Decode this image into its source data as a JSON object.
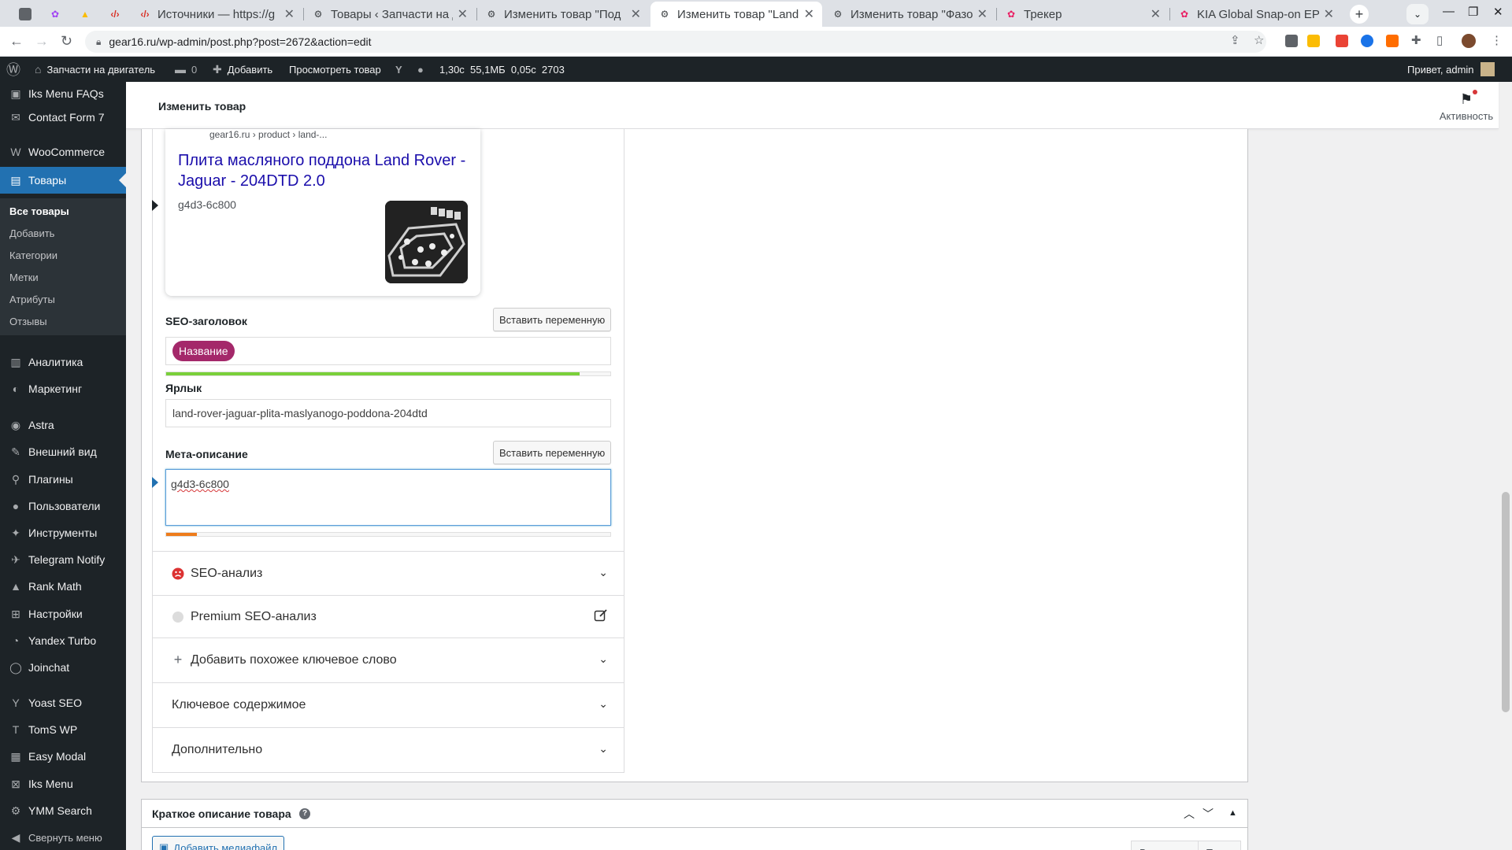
{
  "browser": {
    "tabs": [
      {
        "title": "",
        "favicon_color": "#5f6368"
      },
      {
        "title": "",
        "favicon_color": "#a142f4"
      },
      {
        "title": "",
        "favicon_color": "#fbbc04"
      },
      {
        "title": "",
        "favicon_color": "#d93025"
      },
      {
        "title": "Источники — https://g",
        "favicon_color": "#d93025"
      },
      {
        "title": "Товары ‹ Запчасти на д",
        "favicon_color": "#1d2327"
      },
      {
        "title": "Изменить товар \"Под",
        "favicon_color": "#1d2327"
      },
      {
        "title": "Изменить товар \"Land",
        "favicon_color": "#1d2327"
      },
      {
        "title": "Изменить товар \"Фазо",
        "favicon_color": "#1d2327"
      },
      {
        "title": "Трекер",
        "favicon_color": "#e91e63"
      },
      {
        "title": "KIA Global Snap-on EPC",
        "favicon_color": "#e91e63"
      }
    ],
    "url": "gear16.ru/wp-admin/post.php?post=2672&action=edit"
  },
  "adminbar": {
    "site_name": "Запчасти на двигатель",
    "comments_count": "0",
    "add_new": "Добавить",
    "view_product": "Просмотреть товар",
    "perf": "1,30с  55,1МБ  0,05с  2703",
    "greeting": "Привет, admin"
  },
  "sidebar": {
    "items": [
      {
        "label": "Iks Menu FAQs",
        "icon": "▣"
      },
      {
        "label": "Contact Form 7",
        "icon": "✉"
      },
      {
        "label": "WooCommerce",
        "icon": "W"
      },
      {
        "label": "Товары",
        "icon": "▤"
      },
      {
        "label": "Аналитика",
        "icon": "▥"
      },
      {
        "label": "Маркетинг",
        "icon": "◐"
      },
      {
        "label": "Astra",
        "icon": "◉"
      },
      {
        "label": "Внешний вид",
        "icon": "✎"
      },
      {
        "label": "Плагины",
        "icon": "⚲"
      },
      {
        "label": "Пользователи",
        "icon": "●"
      },
      {
        "label": "Инструменты",
        "icon": "✦"
      },
      {
        "label": "Telegram Notify",
        "icon": "✈"
      },
      {
        "label": "Rank Math",
        "icon": "▲"
      },
      {
        "label": "Настройки",
        "icon": "⊞"
      },
      {
        "label": "Yandex Turbo",
        "icon": "◔"
      },
      {
        "label": "Joinchat",
        "icon": "◯"
      },
      {
        "label": "Yoast SEO",
        "icon": "Y"
      },
      {
        "label": "TomS WP",
        "icon": "T"
      },
      {
        "label": "Easy Modal",
        "icon": "▦"
      },
      {
        "label": "Iks Menu",
        "icon": "⊠"
      },
      {
        "label": "YMM Search",
        "icon": "⚙"
      },
      {
        "label": "Свернуть меню",
        "icon": "◀"
      }
    ],
    "submenu": [
      "Все товары",
      "Добавить",
      "Категории",
      "Метки",
      "Атрибуты",
      "Отзывы"
    ]
  },
  "page": {
    "title": "Изменить товар",
    "activity": "Активность"
  },
  "snippet": {
    "breadcrumb": "gear16.ru › product › land-...",
    "title": "Плита масляного поддона Land Rover - Jaguar - 204DTD 2.0",
    "description": "g4d3-6c800"
  },
  "seo": {
    "seo_title_label": "SEO-заголовок",
    "insert_variable": "Вставить переменную",
    "title_variable_pill": "Название",
    "title_score": 0.93,
    "slug_label": "Ярлык",
    "slug_value": "land-rover-jaguar-plita-maslyanogo-poddona-204dtd",
    "meta_label": "Мета-описание",
    "meta_value": "g4d3-6c800",
    "meta_score": 0.07,
    "colors": {
      "good": "#7ad03a",
      "bad": "#ee7c1b",
      "pill": "#a4286a",
      "link": "#1a0dab"
    }
  },
  "accordion": [
    {
      "label": "SEO-анализ",
      "icon": "sad-face-icon"
    },
    {
      "label": "Premium SEO-анализ",
      "icon": "gray-dot-icon"
    },
    {
      "label": "Добавить похожее ключевое слово",
      "icon": "plus-icon"
    },
    {
      "label": "Ключевое содержимое",
      "icon": ""
    },
    {
      "label": "Дополнительно",
      "icon": ""
    }
  ],
  "short_description": {
    "title": "Краткое описание товара",
    "add_media": "Добавить медиафайл",
    "tab_visual": "Визуально",
    "tab_text": "Текст"
  }
}
